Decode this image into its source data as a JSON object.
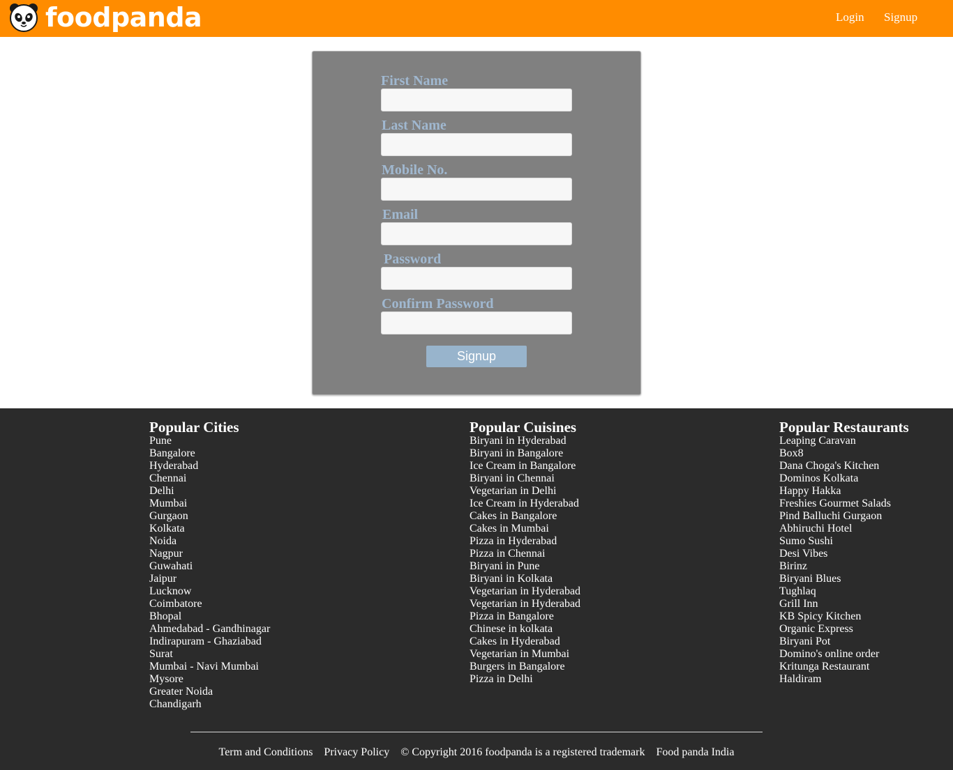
{
  "header": {
    "brand": "foodpanda",
    "nav": {
      "login": "Login",
      "signup": "Signup"
    },
    "colors": {
      "background": "#ff8c00",
      "text": "#ffffff"
    }
  },
  "form": {
    "fields": [
      {
        "label": "First Name",
        "value": ""
      },
      {
        "label": "Last Name",
        "value": ""
      },
      {
        "label": "Mobile No.",
        "value": ""
      },
      {
        "label": "Email",
        "value": ""
      },
      {
        "label": "Password",
        "value": ""
      },
      {
        "label": "Confirm Password",
        "value": ""
      }
    ],
    "submit_label": "Signup",
    "colors": {
      "panel": "#808080",
      "label": "#a0b8d0",
      "button": "#98b4cc"
    }
  },
  "footer": {
    "cities": {
      "title": "Popular Cities",
      "items": [
        "Pune",
        "Bangalore",
        "Hyderabad",
        "Chennai",
        "Delhi",
        "Mumbai",
        "Gurgaon",
        "Kolkata",
        "Noida",
        "Nagpur",
        "Guwahati",
        "Jaipur",
        "Lucknow",
        "Coimbatore",
        "Bhopal",
        "Ahmedabad - Gandhinagar",
        "Indirapuram - Ghaziabad",
        "Surat",
        "Mumbai - Navi Mumbai",
        "Mysore",
        "Greater Noida",
        "Chandigarh"
      ]
    },
    "cuisines": {
      "title": "Popular Cuisines",
      "items": [
        "Biryani in Hyderabad",
        "Biryani in Bangalore",
        "Ice Cream in Bangalore",
        "Biryani in Chennai",
        "Vegetarian in Delhi",
        "Ice Cream in Hyderabad",
        "Cakes in Bangalore",
        "Cakes in Mumbai",
        "Pizza in Hyderabad",
        "Pizza in Chennai",
        "Biryani in Pune",
        "Biryani in Kolkata",
        "Vegetarian in Hyderabad",
        "Vegetarian in Hyderabad",
        "Pizza in Bangalore",
        "Chinese in kolkata",
        "Cakes in Hyderabad",
        "Vegetarian in Mumbai",
        "Burgers in Bangalore",
        "Pizza in Delhi"
      ]
    },
    "restaurants": {
      "title": "Popular Restaurants",
      "items": [
        "Leaping Caravan",
        "Box8",
        "Dana Choga's Kitchen",
        "Dominos Kolkata",
        "Happy Hakka",
        "Freshies Gourmet Salads",
        "Pind Balluchi Gurgaon",
        "Abhiruchi Hotel",
        "Sumo Sushi",
        "Desi Vibes",
        "Birinz",
        "Biryani Blues",
        "Tughlaq",
        "Grill Inn",
        "KB Spicy Kitchen",
        "Organic Express",
        "Biryani Pot",
        "Domino's online order",
        "Kritunga Restaurant",
        "Haldiram"
      ]
    },
    "bottom": {
      "terms": "Term and Conditions",
      "privacy": "Privacy Policy",
      "copyright": "© Copyright 2016 foodpanda is a registered trademark",
      "india": "Food panda India"
    },
    "colors": {
      "background": "#2b2b2b",
      "text": "#ffffff"
    }
  }
}
